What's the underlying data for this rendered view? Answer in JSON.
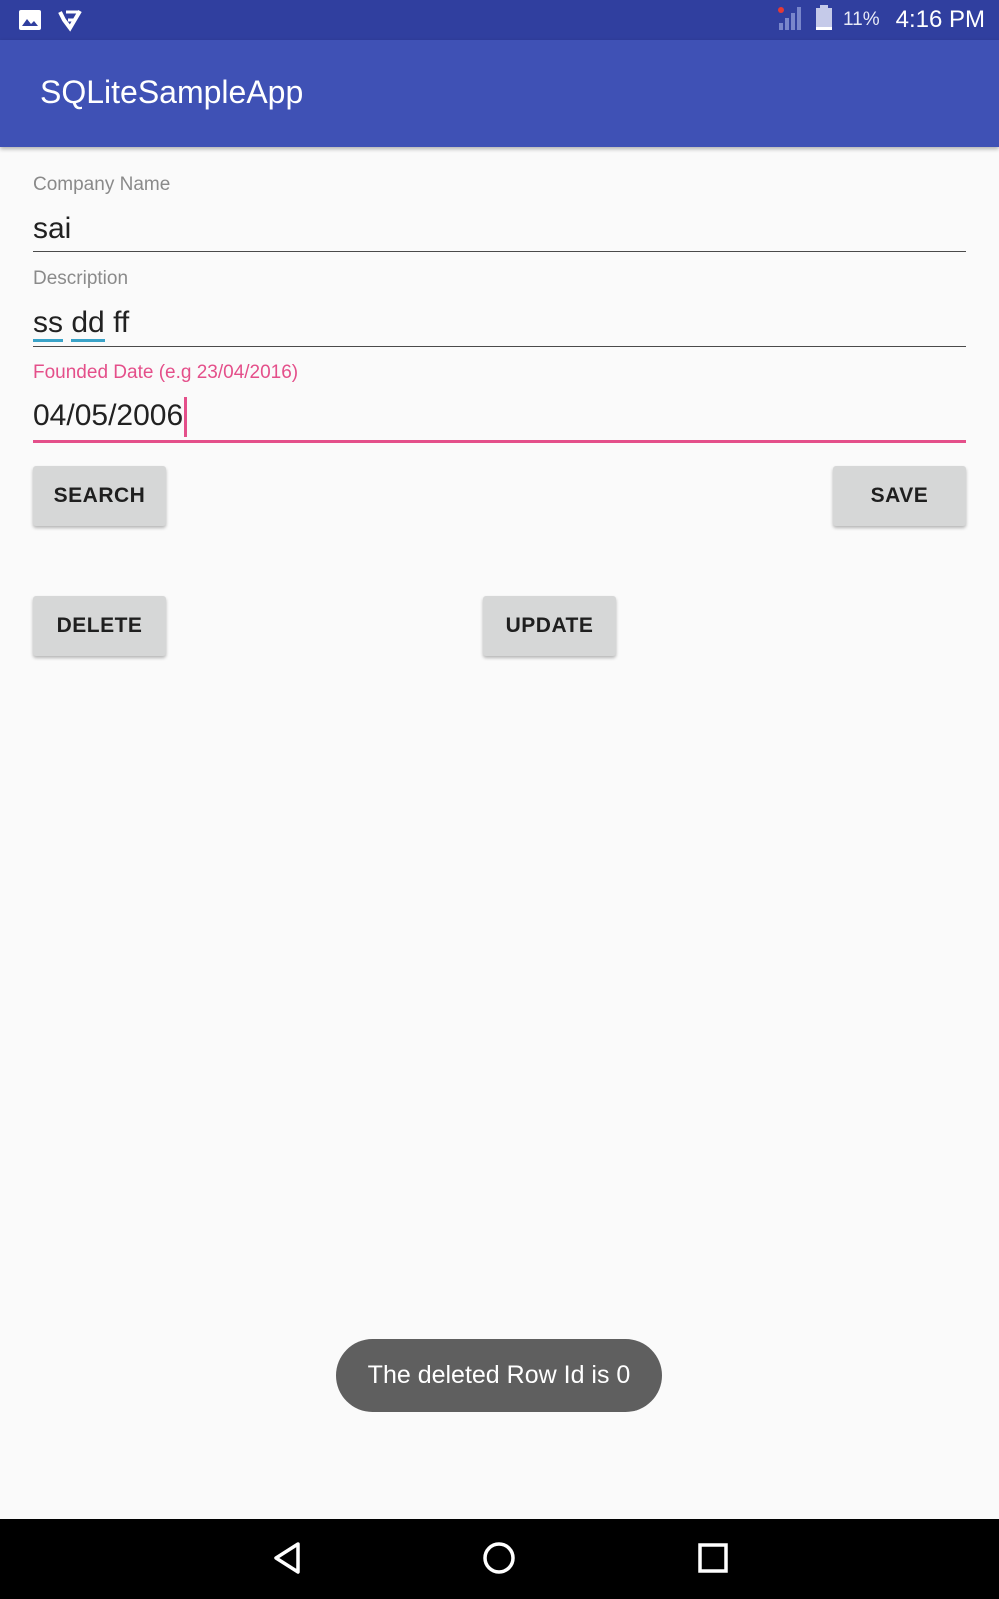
{
  "status_bar": {
    "battery_percent": "11%",
    "time": "4:16 PM",
    "icons": [
      "image-icon",
      "checklist-icon",
      "signal-icon",
      "battery-icon"
    ]
  },
  "app_bar": {
    "title": "SQLiteSampleApp"
  },
  "form": {
    "company_name": {
      "label": "Company Name",
      "value": "sai"
    },
    "description": {
      "label": "Description",
      "words": [
        "ss",
        "dd",
        "ff"
      ]
    },
    "founded_date": {
      "label": "Founded Date (e.g 23/04/2016)",
      "value": "04/05/2006"
    }
  },
  "buttons": {
    "search": "SEARCH",
    "save": "SAVE",
    "delete": "DELETE",
    "update": "UPDATE"
  },
  "toast": {
    "message": "The deleted Row Id is 0"
  },
  "nav_bar": {
    "icons": [
      "back-icon",
      "home-icon",
      "recents-icon"
    ]
  },
  "colors": {
    "status_bar": "#303f9f",
    "app_bar": "#3f51b5",
    "accent": "#e44f8a",
    "spellcheck": "#3aa3c8"
  }
}
